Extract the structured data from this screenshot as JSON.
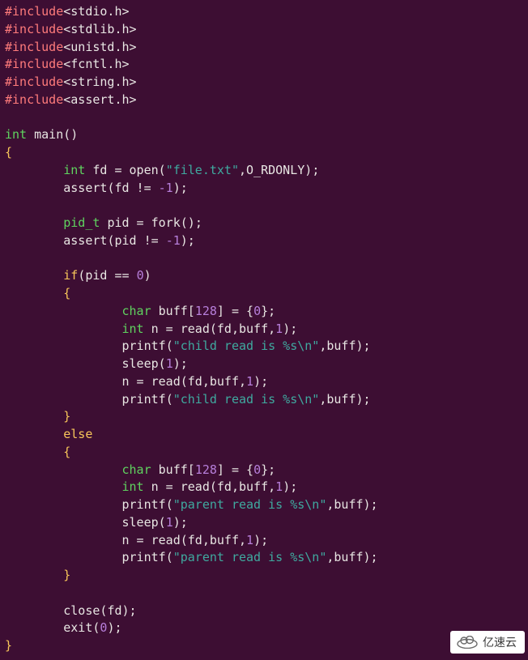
{
  "includes": [
    {
      "directive": "#include",
      "path": "<stdio.h>"
    },
    {
      "directive": "#include",
      "path": "<stdlib.h>"
    },
    {
      "directive": "#include",
      "path": "<unistd.h>"
    },
    {
      "directive": "#include",
      "path": "<fcntl.h>"
    },
    {
      "directive": "#include",
      "path": "<string.h>"
    },
    {
      "directive": "#include",
      "path": "<assert.h>"
    }
  ],
  "sig": {
    "int": "int",
    "main": "main",
    "parens": "()"
  },
  "decl": {
    "int": "int",
    "fd": "fd",
    "eq": " = ",
    "open": "open",
    "lp": "(",
    "file": "\"file.txt\"",
    "comma": ",",
    "flag": "O_RDONLY",
    "rp": ")",
    "semi": ";"
  },
  "assert1": {
    "call": "assert",
    "lp": "(",
    "arg_a": "fd != ",
    "neg1": "-1",
    "rp": ")",
    "semi": ";"
  },
  "pid_decl": {
    "type": "pid_t",
    "name": "pid",
    "eq": " = ",
    "fork": "fork",
    "parens": "()",
    "semi": ";"
  },
  "assert2": {
    "call": "assert",
    "lp": "(",
    "arg_a": "pid != ",
    "neg1": "-1",
    "rp": ")",
    "semi": ";"
  },
  "ifline": {
    "if": "if",
    "lp": "(",
    "cond_a": "pid == ",
    "zero": "0",
    "rp": ")"
  },
  "brace_open": "{",
  "brace_close": "}",
  "child": {
    "buf": {
      "char": "char",
      "name": "buff",
      "lb": "[",
      "size": "128",
      "rb": "]",
      "eq": " = {",
      "zero": "0",
      "end": "};"
    },
    "read1": {
      "int": "int",
      "n": "n",
      "eq": " = ",
      "read": "read",
      "lp": "(",
      "args_a": "fd,buff,",
      "one": "1",
      "rp": ")",
      "semi": ";"
    },
    "print1": {
      "printf": "printf",
      "lp": "(",
      "fmt": "\"child read is %s\\n\"",
      "rest": ",buff);",
      "rp": ""
    },
    "sleep": {
      "sleep": "sleep",
      "lp": "(",
      "one": "1",
      "rp": ")",
      "semi": ";"
    },
    "read2": {
      "lhs": "n = ",
      "read": "read",
      "lp": "(",
      "args_a": "fd,buff,",
      "one": "1",
      "rp": ")",
      "semi": ";"
    },
    "print2": {
      "printf": "printf",
      "lp": "(",
      "fmt": "\"child read is %s\\n\"",
      "rest": ",buff);"
    }
  },
  "else_kw": "else",
  "parent": {
    "buf": {
      "char": "char",
      "name": "buff",
      "lb": "[",
      "size": "128",
      "rb": "]",
      "eq": " = {",
      "zero": "0",
      "end": "};"
    },
    "read1": {
      "int": "int",
      "n": "n",
      "eq": " = ",
      "read": "read",
      "lp": "(",
      "args_a": "fd,buff,",
      "one": "1",
      "rp": ")",
      "semi": ";"
    },
    "print1": {
      "printf": "printf",
      "lp": "(",
      "fmt": "\"parent read is %s\\n\"",
      "rest": ",buff);"
    },
    "sleep": {
      "sleep": "sleep",
      "lp": "(",
      "one": "1",
      "rp": ")",
      "semi": ";"
    },
    "read2": {
      "lhs": "n = ",
      "read": "read",
      "lp": "(",
      "args_a": "fd,buff,",
      "one": "1",
      "rp": ")",
      "semi": ";"
    },
    "print2": {
      "printf": "printf",
      "lp": "(",
      "fmt": "\"parent read is %s\\n\"",
      "rest": ",buff);"
    }
  },
  "close": {
    "close": "close",
    "lp": "(",
    "arg": "fd",
    "rp": ")",
    "semi": ";"
  },
  "exit": {
    "exit": "exit",
    "lp": "(",
    "zero": "0",
    "rp": ")",
    "semi": ";"
  },
  "watermark": {
    "text": "亿速云"
  }
}
